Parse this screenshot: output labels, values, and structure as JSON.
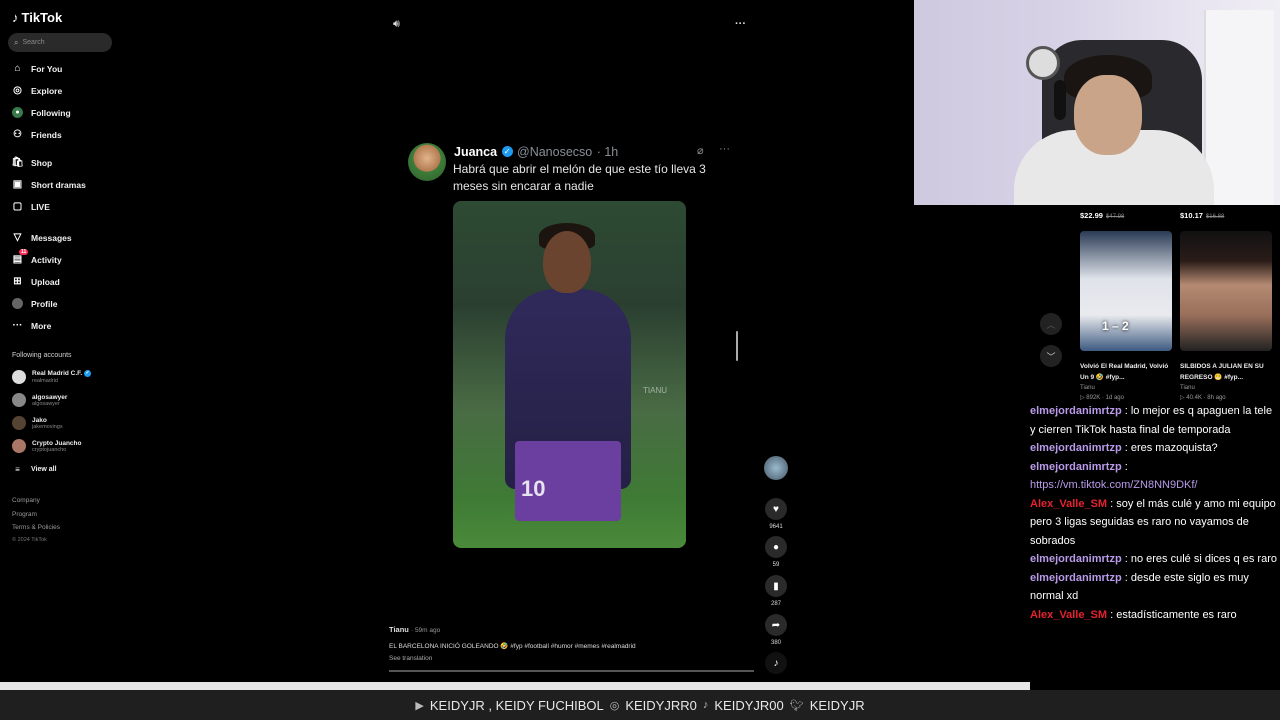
{
  "brand": {
    "name": "TikTok"
  },
  "search": {
    "placeholder": "Search"
  },
  "nav": [
    {
      "label": "For You",
      "icon": "home-icon"
    },
    {
      "label": "Explore",
      "icon": "compass-icon"
    },
    {
      "label": "Following",
      "icon": "following-icon"
    },
    {
      "label": "Friends",
      "icon": "friends-icon"
    },
    {
      "label": "Shop",
      "icon": "shop-icon"
    },
    {
      "label": "Short dramas",
      "icon": "dramas-icon"
    },
    {
      "label": "LIVE",
      "icon": "live-icon"
    },
    {
      "label": "Messages",
      "icon": "messages-icon"
    },
    {
      "label": "Activity",
      "icon": "activity-icon",
      "badge": "11"
    },
    {
      "label": "Upload",
      "icon": "upload-icon"
    },
    {
      "label": "Profile",
      "icon": "profile-icon"
    },
    {
      "label": "More",
      "icon": "more-icon"
    }
  ],
  "following_accounts": {
    "title": "Following accounts",
    "items": [
      {
        "name": "Real Madrid C.F.",
        "handle": "realmadrid"
      },
      {
        "name": "algosawyer",
        "handle": "algosawyer"
      },
      {
        "name": "Jako",
        "handle": "jakemovings"
      },
      {
        "name": "Crypto Juancho",
        "handle": "cryptojuancho"
      }
    ],
    "view_all": "View all"
  },
  "footer": {
    "links": [
      "Company",
      "Program",
      "Terms & Policies"
    ],
    "copyright": "© 2024 TikTok"
  },
  "tweet": {
    "name": "Juanca",
    "handle": "@Nanosecso",
    "time": "· 1h",
    "text": "Habrá que abrir el melón de que este tío lleva 3 meses sin encarar a nadie",
    "watermark": "TIANU"
  },
  "actions": {
    "likes": "9641",
    "comments": "59",
    "saves": "287",
    "shares": "380"
  },
  "caption": {
    "user": "Tianu",
    "time": "· 59m ago",
    "desc": "EL BARCELONA INICIÓ GOLEANDO 🤣 #fyp #football #humor #memes #realmadrid",
    "translate": "See translation"
  },
  "recommended": [
    {
      "price": "$22.99",
      "old": "$47.98",
      "title": "Volvió El Real Madrid, Volvió Un 9 🤣 #fyp...",
      "author": "Tianu",
      "stats": "▷ 892K · 1d ago",
      "score": "1 – 2"
    },
    {
      "price": "$10.17",
      "old": "$16.88",
      "title": "SILBIDOS A JULIAN EN SU REGRESO 😬 #fyp...",
      "author": "Tianu",
      "stats": "▷ 40.4K · 8h ago"
    }
  ],
  "chat": [
    {
      "user": "elmejordanimrtzp",
      "text": " : lo mejor es q apaguen la tele y cierren TikTok hasta final de temporada",
      "color": "purple"
    },
    {
      "user": "elmejordanimrtzp",
      "text": " : eres mazoquista?",
      "color": "purple"
    },
    {
      "user": "elmejordanimrtzp",
      "text": " :",
      "link": "https://vm.tiktok.com/ZN8NN9DKf/",
      "color": "purple"
    },
    {
      "user": "Alex_Valle_SM",
      "text": " : soy el más culé y amo mi equipo pero 3 ligas seguidas es raro no vayamos de sobrados",
      "color": "red"
    },
    {
      "user": "elmejordanimrtzp",
      "text": " : no eres culé si dices q es raro",
      "color": "purple"
    },
    {
      "user": "elmejordanimrtzp",
      "text": " : desde este siglo es muy normal xd",
      "color": "purple"
    },
    {
      "user": "Alex_Valle_SM",
      "text": " : estadísticamente es raro",
      "color": "red"
    }
  ],
  "socials": {
    "youtube": "KEIDYJR , KEIDY FUCHIBOL",
    "instagram": "KEIDYJRR0",
    "tiktok": "KEIDYJR00",
    "twitter": "KEIDYJR"
  },
  "colors": {
    "accent": "#fe2c55",
    "verified": "#1d9bf0",
    "chat_purple": "#b99bea",
    "chat_red": "#e5232f"
  }
}
